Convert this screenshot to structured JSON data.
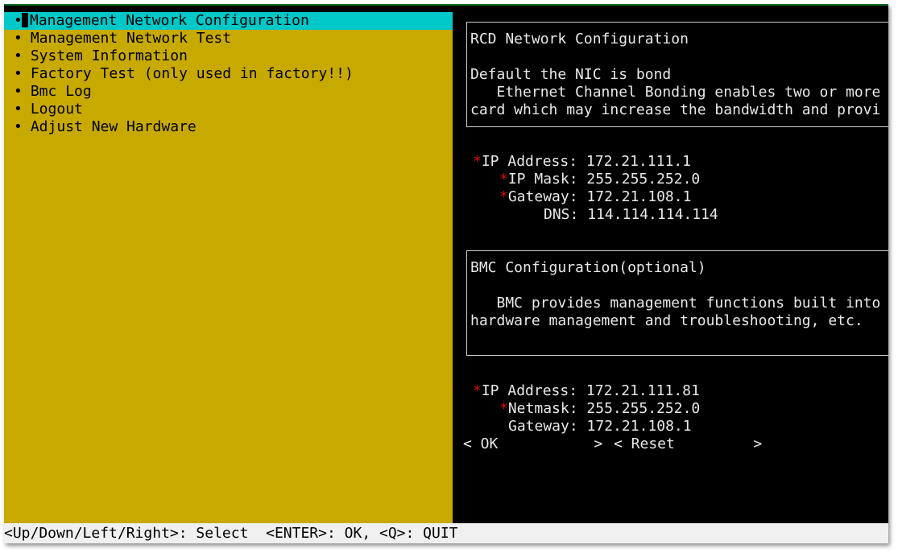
{
  "menu": {
    "bullet": "•",
    "items": [
      "Management Network Configuration",
      "Management Network Test",
      "System Information",
      "Factory Test (only used in factory!!)",
      "Bmc Log",
      "Logout",
      "Adjust New Hardware"
    ]
  },
  "rcd": {
    "title": "RCD Network Configuration",
    "line1": "Default the NIC is bond",
    "line2": "   Ethernet Channel Bonding enables two or more",
    "line3": "card which may increase the bandwidth and provi"
  },
  "network": {
    "star": "*",
    "ip_label": "IP Address:",
    "ip_value": "172.21.111.1",
    "mask_label": "IP Mask:",
    "mask_value": "255.255.252.0",
    "gateway_label": "Gateway:",
    "gateway_value": "172.21.108.1",
    "dns_label": "DNS:",
    "dns_value": "114.114.114.114"
  },
  "bmc": {
    "title": "BMC Configuration(optional)",
    "line1": "   BMC provides management functions built into",
    "line2": "hardware management and troubleshooting, etc.",
    "ip_label": "IP Address:",
    "ip_value": "172.21.111.81",
    "netmask_label": "Netmask:",
    "netmask_value": "255.255.252.0",
    "gateway_label": "Gateway:",
    "gateway_value": "172.21.108.1"
  },
  "buttons": {
    "ok": "< OK           >",
    "reset": "< Reset         >"
  },
  "status": "<Up/Down/Left/Right>: Select  <ENTER>: OK, <Q>: QUIT",
  "colors": {
    "menu_bg": "#c8a900",
    "selected_bg": "#00c8c8",
    "required_star": "#d01010"
  }
}
